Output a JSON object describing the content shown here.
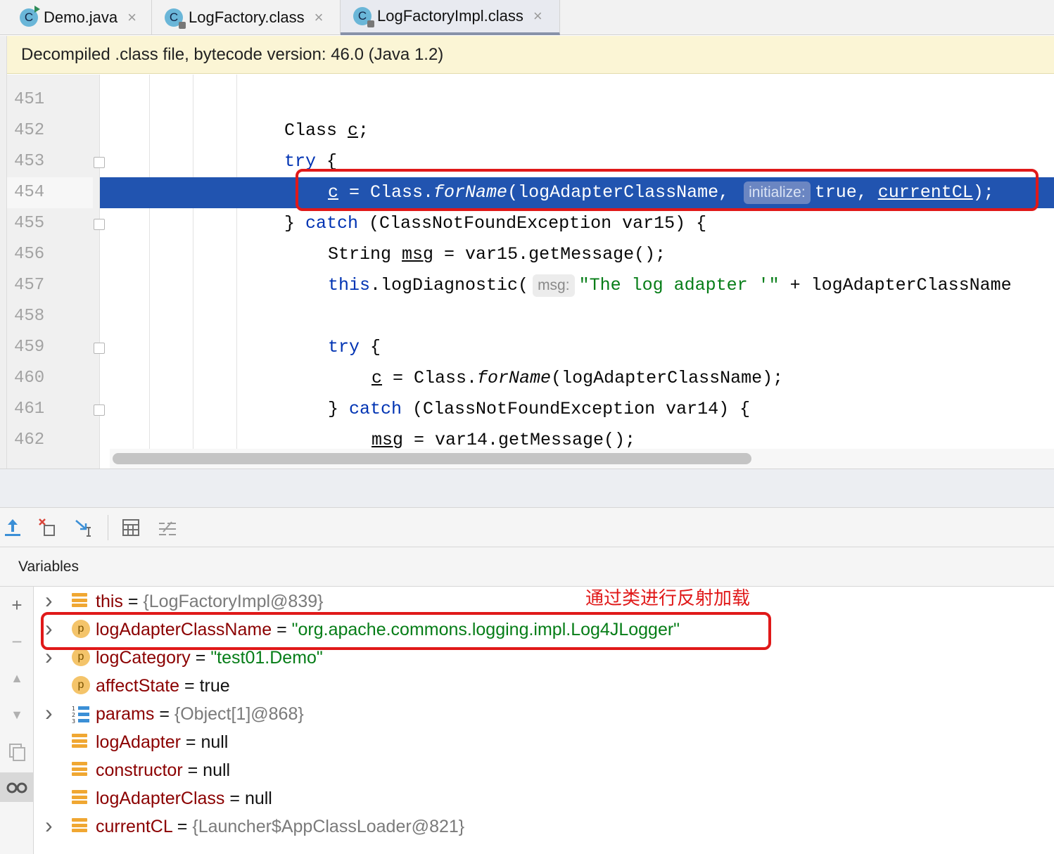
{
  "tabs": [
    {
      "label": "Demo.java",
      "icon": "java-class-run-icon",
      "active": false
    },
    {
      "label": "LogFactory.class",
      "icon": "class-locked-icon",
      "active": false
    },
    {
      "label": "LogFactoryImpl.class",
      "icon": "class-locked-icon",
      "active": true
    }
  ],
  "banner": "Decompiled .class file, bytecode version: 46.0 (Java 1.2)",
  "editor": {
    "line_numbers": [
      "451",
      "452",
      "453",
      "454",
      "455",
      "456",
      "457",
      "458",
      "459",
      "460",
      "461",
      "462"
    ],
    "current_line": "454",
    "hints": {
      "initialize": "initialize:",
      "msg": "msg:"
    }
  },
  "debugger": {
    "variables_title": "Variables",
    "variables": [
      {
        "name": "this",
        "eq": " = ",
        "value": "{LogFactoryImpl@839}",
        "kind": "object",
        "icon": "field-icon",
        "expandable": true
      },
      {
        "name": "logAdapterClassName",
        "eq": " = ",
        "value": "\"org.apache.commons.logging.impl.Log4JLogger\"",
        "kind": "string",
        "icon": "parameter-icon",
        "expandable": true
      },
      {
        "name": "logCategory",
        "eq": " = ",
        "value": "\"test01.Demo\"",
        "kind": "string",
        "icon": "parameter-icon",
        "expandable": true
      },
      {
        "name": "affectState",
        "eq": " = ",
        "value": "true",
        "kind": "primitive",
        "icon": "parameter-icon",
        "expandable": false
      },
      {
        "name": "params",
        "eq": " = ",
        "value": "{Object[1]@868}",
        "kind": "object",
        "icon": "array-icon",
        "expandable": true
      },
      {
        "name": "logAdapter",
        "eq": " = ",
        "value": "null",
        "kind": "primitive",
        "icon": "field-icon",
        "expandable": false
      },
      {
        "name": "constructor",
        "eq": " = ",
        "value": "null",
        "kind": "primitive",
        "icon": "field-icon",
        "expandable": false
      },
      {
        "name": "logAdapterClass",
        "eq": " = ",
        "value": "null",
        "kind": "primitive",
        "icon": "field-icon",
        "expandable": false
      },
      {
        "name": "currentCL",
        "eq": " = ",
        "value": "{Launcher$AppClassLoader@821}",
        "kind": "object",
        "icon": "field-icon",
        "expandable": true
      }
    ],
    "param_icon_letter": "p"
  },
  "annotation": "通过类进行反射加载",
  "colors": {
    "highlight": "#2154b0",
    "annotation_red": "#e01919",
    "string_green": "#067d17",
    "keyword_blue": "#0033b3",
    "var_name": "#8b0000"
  }
}
